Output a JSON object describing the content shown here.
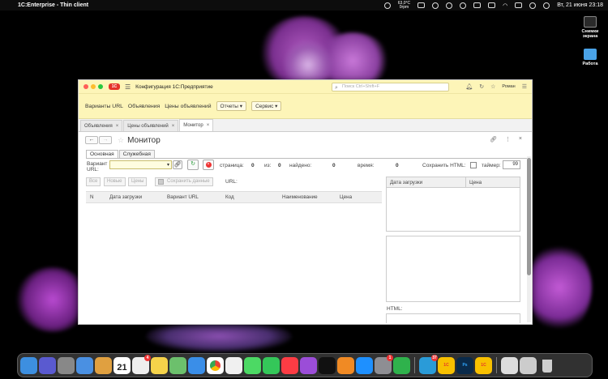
{
  "menubar": {
    "app_title": "1C:Enterprise - Thin client",
    "temp_line1": "63,0°C",
    "temp_line2": "0rpm",
    "date_time": "Вт, 21 июня  23:18"
  },
  "desktop": {
    "icons": [
      {
        "label": "Снимки экрана"
      },
      {
        "label": "Работа"
      }
    ]
  },
  "window": {
    "title": "Конфигурация 1С:Предприятие",
    "logo_text": "1С",
    "search_placeholder": "Поиск Ctrl+Shift+F",
    "user": "Роман",
    "colors": {
      "titlebar": "#fdf5b8",
      "close": "#ff5f57",
      "minimize": "#febc2e",
      "zoom": "#28c840"
    }
  },
  "sections": {
    "items": [
      "Варианты URL",
      "Объявления",
      "Цены объявлений"
    ],
    "menus": [
      "Отчеты",
      "Сервис"
    ]
  },
  "open_tabs": [
    {
      "label": "Объявления",
      "active": false
    },
    {
      "label": "Цены объявлений",
      "active": false
    },
    {
      "label": "Монитор",
      "active": true
    }
  ],
  "form": {
    "title": "Монитор",
    "tabs": [
      "Основная",
      "Служебная"
    ],
    "variant_label_1": "Вариант",
    "variant_label_2": "URL:",
    "variant_value": "",
    "page_label": "страница:",
    "page_value": "0",
    "of_label": "из:",
    "of_value": "0",
    "found_label": "найдено:",
    "found_value": "0",
    "time_label": "время:",
    "time_value": "0",
    "save_html_label": "Сохранить HTML:",
    "timer_label": "таймер:",
    "timer_value": "99",
    "btn_all": "Все",
    "btn_new": "Новые",
    "btn_prices": "Цены",
    "btn_save_data": "Сохранить данные",
    "url_label": "URL:",
    "html_label": "HTML:",
    "grid_columns": [
      "N",
      "Дата загрузки",
      "Вариант URL",
      "Код",
      "Наименование",
      "Цена"
    ],
    "side_grid_columns": [
      "Дата загрузки",
      "Цена"
    ]
  }
}
